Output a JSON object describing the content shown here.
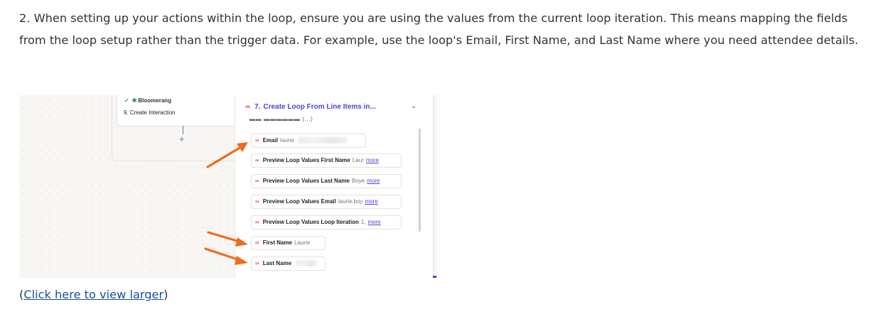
{
  "article": {
    "step_text": "2. When setting up your actions within the loop, ensure you are using the values from the current loop iteration. This means mapping the fields from the loop setup rather than the trigger data. For example, use the loop's Email, First Name, and Last Name where you need attendee details.",
    "link_open": "(",
    "link_text": "Click here to view larger",
    "link_close": ")"
  },
  "screenshot": {
    "canvas_card": {
      "app_name": "Bloomerang",
      "step_title": "9. Create Interaction"
    },
    "panel": {
      "header_number": "7.",
      "header_title": "Create Loop From Line Items in...",
      "fields": [
        {
          "label": "Email",
          "value": "laurie."
        },
        {
          "label": "Preview Loop Values First Name",
          "value": "Laur",
          "more": "more"
        },
        {
          "label": "Preview Loop Values Last Name",
          "value": "Boye",
          "more": "more"
        },
        {
          "label": "Preview Loop Values Email",
          "value": "laurie.boy",
          "more": "more"
        },
        {
          "label": "Preview Loop Values Loop Iteration",
          "value": "1,",
          "more": "more"
        },
        {
          "label": "First Name",
          "value": "Laurie"
        },
        {
          "label": "Last Name",
          "value": ""
        }
      ]
    },
    "accent_colors": {
      "arrow": "#f26a1b",
      "link": "#4c46d8",
      "loop_icon": "#e0533c"
    }
  }
}
